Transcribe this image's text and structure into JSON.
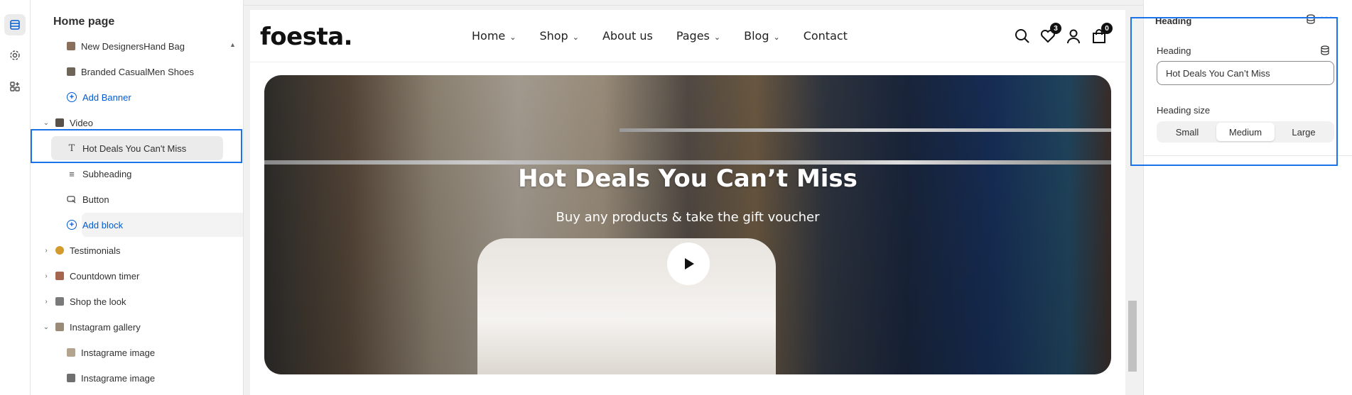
{
  "sidebar": {
    "title": "Home page",
    "items": [
      {
        "label": "New DesignersHand Bag",
        "kind": "image",
        "color": "#8a6f5a"
      },
      {
        "label": "Branded CasualMen Shoes",
        "kind": "image",
        "color": "#6e6458"
      },
      {
        "label": "Add Banner",
        "kind": "add"
      },
      {
        "label": "Video",
        "kind": "section",
        "expanded": true,
        "color": "#5a5148"
      },
      {
        "label": "Hot Deals You Can't Miss",
        "kind": "text",
        "selected": true,
        "icon": "T"
      },
      {
        "label": "Subheading",
        "kind": "text",
        "icon": "≡"
      },
      {
        "label": "Button",
        "kind": "button"
      },
      {
        "label": "Add block",
        "kind": "add"
      },
      {
        "label": "Testimonials",
        "kind": "section",
        "expanded": false,
        "color": "#d39a2e"
      },
      {
        "label": "Countdown timer",
        "kind": "section",
        "expanded": false,
        "color": "#a4664d"
      },
      {
        "label": "Shop the look",
        "kind": "section",
        "expanded": false,
        "color": "#7a7a7a"
      },
      {
        "label": "Instagram gallery",
        "kind": "section",
        "expanded": true,
        "color": "#9a8b78"
      },
      {
        "label": "Instagrame image",
        "kind": "image",
        "color": "#b5a48d"
      },
      {
        "label": "Instagrame image",
        "kind": "image",
        "color": "#6f6f6f"
      }
    ]
  },
  "store": {
    "logo": "foesta.",
    "nav": [
      {
        "label": "Home",
        "dropdown": true
      },
      {
        "label": "Shop",
        "dropdown": true
      },
      {
        "label": "About us",
        "dropdown": false
      },
      {
        "label": "Pages",
        "dropdown": true
      },
      {
        "label": "Blog",
        "dropdown": true
      },
      {
        "label": "Contact",
        "dropdown": false
      }
    ],
    "wishlist_count": "3",
    "cart_count": "0",
    "hero": {
      "title": "Hot Deals You Can’t Miss",
      "subtitle": "Buy any products & take the gift voucher"
    }
  },
  "panel": {
    "title": "Heading",
    "heading_label": "Heading",
    "heading_value": "Hot Deals You Can’t Miss",
    "size_label": "Heading size",
    "sizes": [
      "Small",
      "Medium",
      "Large"
    ],
    "selected_size": "Medium"
  },
  "colors": {
    "accent": "#005bd3",
    "highlight": "#1a73e8"
  }
}
